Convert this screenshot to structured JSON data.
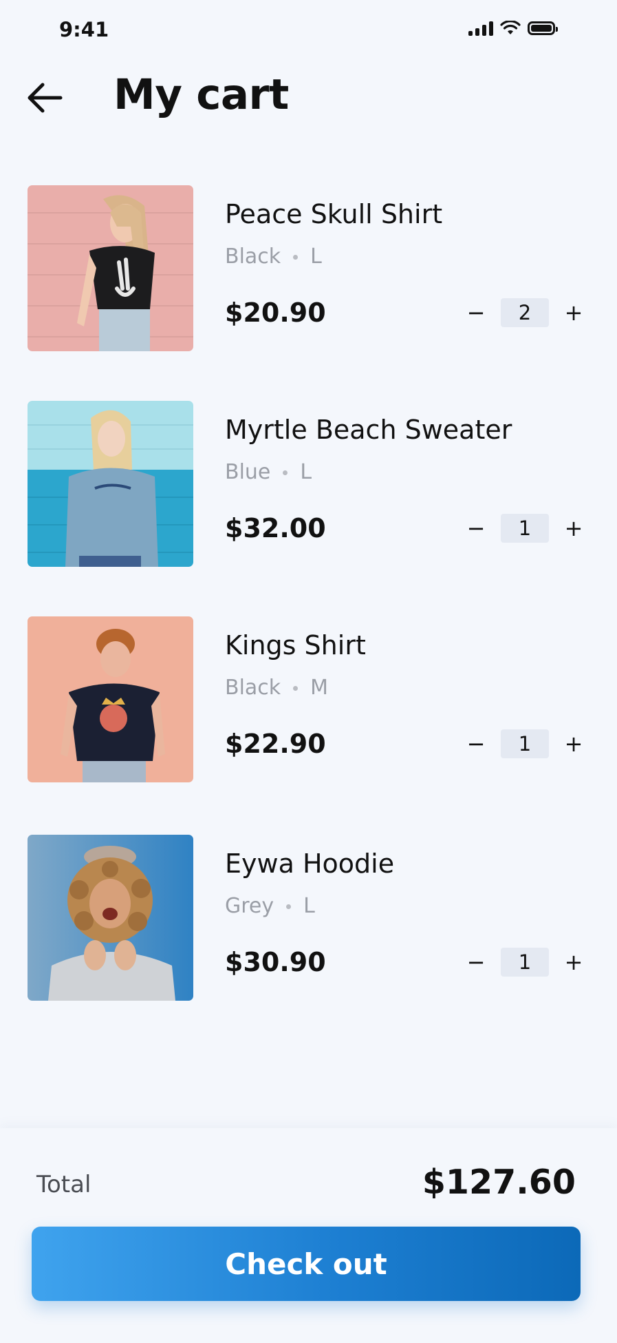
{
  "status_bar": {
    "time": "9:41"
  },
  "header": {
    "title": "My cart"
  },
  "items": [
    {
      "name": "Peace Skull Shirt",
      "color": "Black",
      "size": "L",
      "price": "$20.90",
      "quantity": "2"
    },
    {
      "name": "Myrtle Beach Sweater",
      "color": "Blue",
      "size": "L",
      "price": "$32.00",
      "quantity": "1"
    },
    {
      "name": "Kings Shirt",
      "color": "Black",
      "size": "M",
      "price": "$22.90",
      "quantity": "1"
    },
    {
      "name": "Eywa Hoodie",
      "color": "Grey",
      "size": "L",
      "price": "$30.90",
      "quantity": "1"
    }
  ],
  "stepper": {
    "minus": "−",
    "plus": "+"
  },
  "footer": {
    "total_label": "Total",
    "total_value": "$127.60",
    "checkout_label": "Check out"
  },
  "colors": {
    "background": "#f4f7fc",
    "accent": "#1d7fd2",
    "muted_text": "#9a9ea6"
  }
}
